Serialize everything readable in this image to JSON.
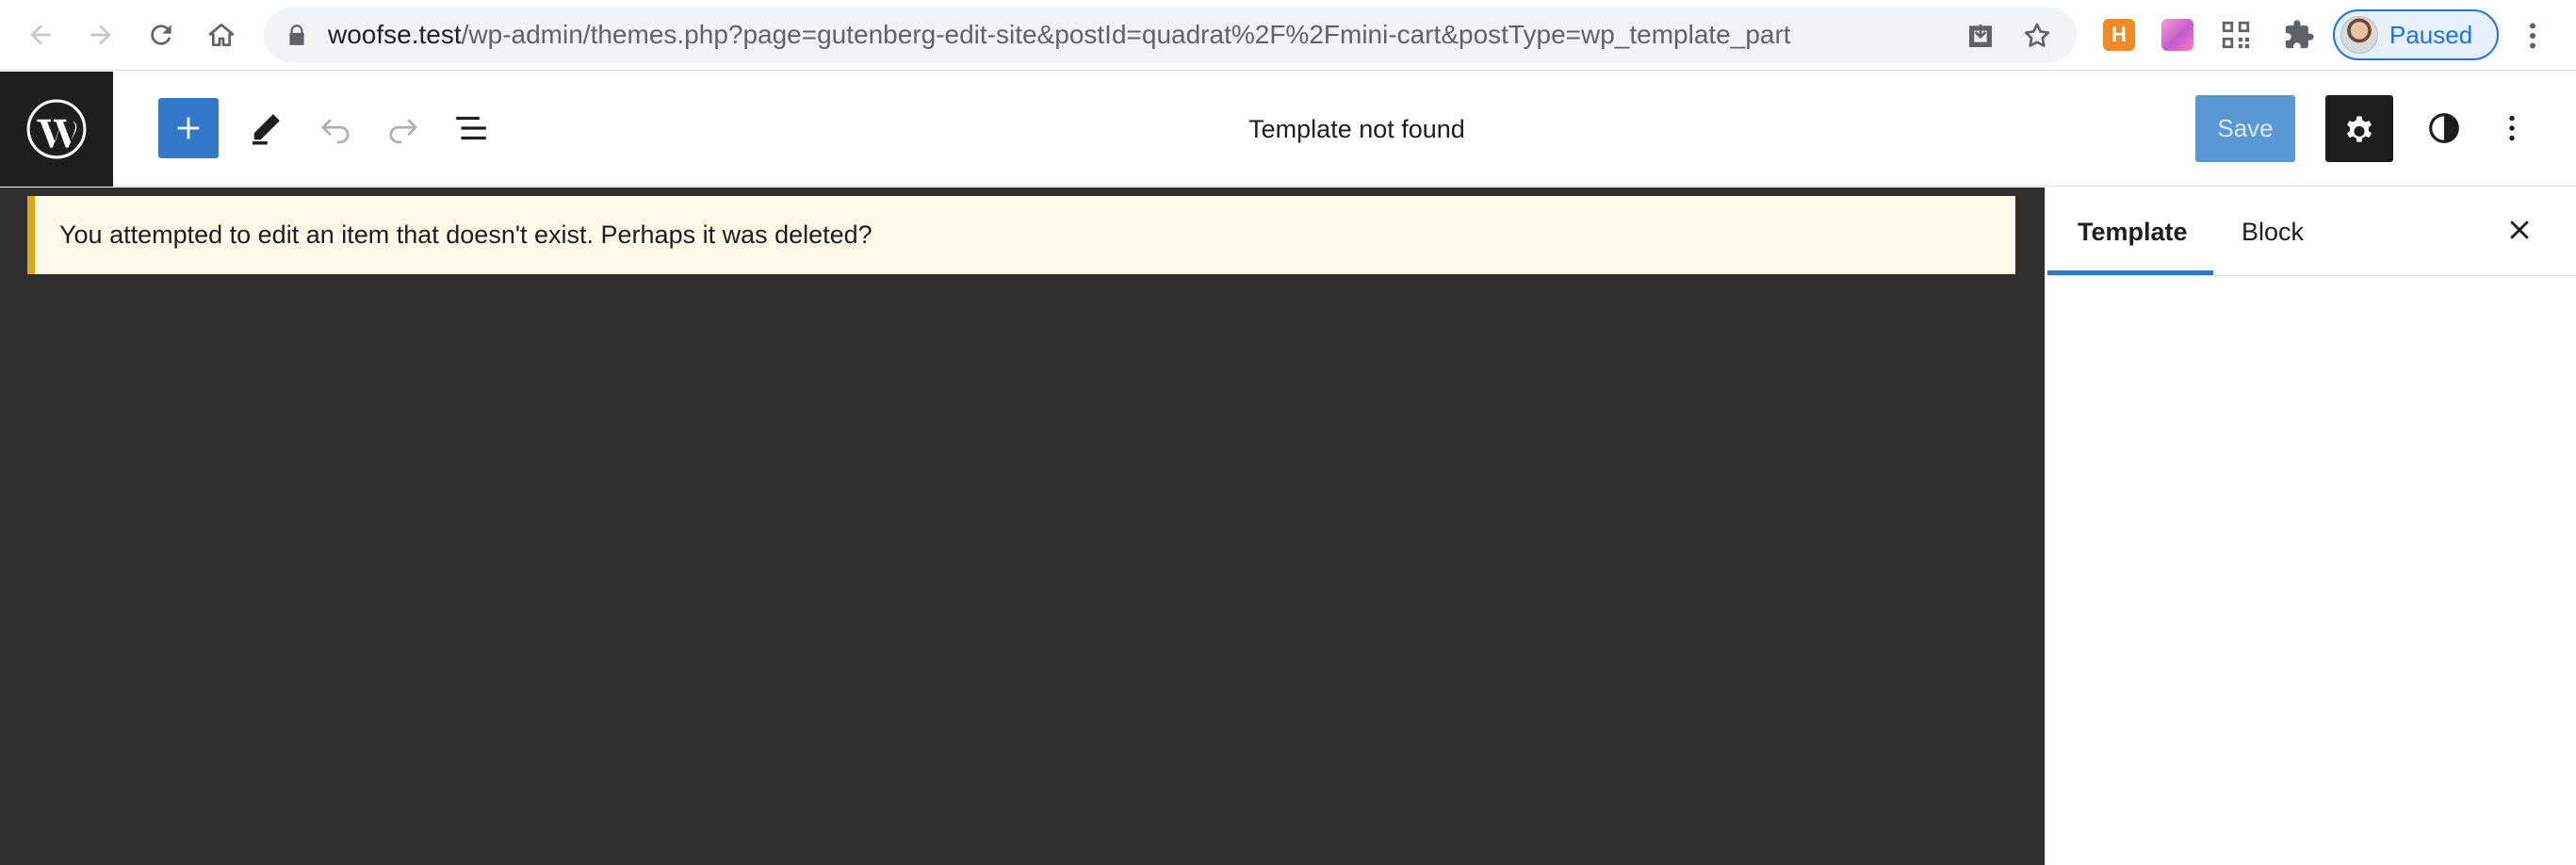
{
  "browser": {
    "url_host": "woofse.test",
    "url_path": "/wp-admin/themes.php?page=gutenberg-edit-site&postId=quadrat%2F%2Fmini-cart&postType=wp_template_part",
    "extension_h_label": "H",
    "profile_status": "Paused",
    "icons": [
      "back-icon",
      "forward-icon",
      "reload-icon",
      "home-icon",
      "lock-icon",
      "install-icon",
      "star-icon",
      "extension-h-icon",
      "extension-gradient-icon",
      "qr-code-icon",
      "puzzle-icon",
      "avatar",
      "kebab-menu-icon"
    ]
  },
  "editor_header": {
    "document_title": "Template not found",
    "save_label": "Save",
    "icons": [
      "wordpress-logo",
      "plus-icon",
      "pencil-icon",
      "undo-icon",
      "redo-icon",
      "list-view-icon",
      "gear-icon",
      "half-circle-icon",
      "more-vertical-icon"
    ],
    "colors": {
      "accent": "#3278c8",
      "dark": "#1e1e1e"
    }
  },
  "canvas": {
    "notice_text": "You attempted to edit an item that doesn't exist. Perhaps it was deleted?",
    "colors": {
      "background": "#2f2f2f",
      "notice_bg": "#fcf9e8",
      "notice_border": "#dba617"
    }
  },
  "sidebar": {
    "tabs": [
      {
        "label": "Template",
        "active": true
      },
      {
        "label": "Block",
        "active": false
      }
    ]
  }
}
